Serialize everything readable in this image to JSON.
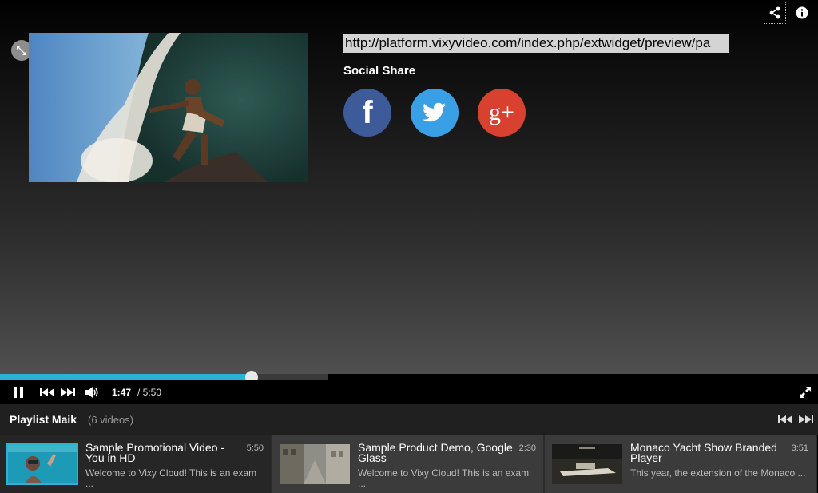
{
  "share": {
    "url": "http://platform.vixyvideo.com/index.php/extwidget/preview/pa",
    "title": "Social Share",
    "networks": [
      {
        "name": "facebook",
        "glyph": "f",
        "color": "#3d5a99"
      },
      {
        "name": "twitter",
        "color": "#39a0e6"
      },
      {
        "name": "google-plus",
        "glyph": "g+",
        "color": "#d8412f"
      }
    ]
  },
  "player": {
    "current_time": "1:47",
    "duration": "/ 5:50",
    "progress_fraction": 0.768
  },
  "playlist": {
    "title": "Playlist Maik",
    "count": "(6 videos)",
    "items": [
      {
        "name": "Sample Promotional Video - You in HD",
        "desc": "Welcome to Vixy Cloud! This is an exam ...",
        "duration": "5:50",
        "active": true
      },
      {
        "name": "Sample Product Demo, Google Glass",
        "desc": "Welcome to Vixy Cloud! This is an exam ...",
        "duration": "2:30",
        "active": false
      },
      {
        "name": "Monaco Yacht Show Branded Player",
        "desc": "This year, the extension of the Monaco ...",
        "duration": "3:51",
        "active": false
      }
    ]
  },
  "colors": {
    "accent": "#2bb3d6"
  },
  "icons": [
    "share-icon",
    "info-icon",
    "resize-icon",
    "pause-icon",
    "previous-icon",
    "next-icon",
    "volume-icon",
    "fullscreen-icon"
  ]
}
